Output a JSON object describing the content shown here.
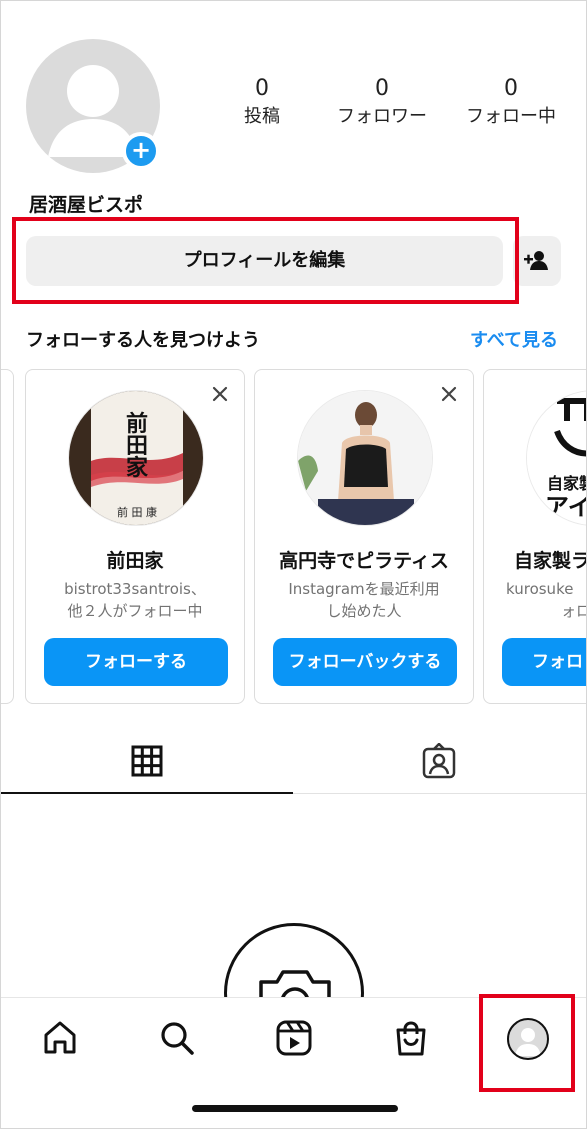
{
  "profile": {
    "name": "居酒屋ビスポ",
    "stats": [
      {
        "value": "0",
        "label": "投稿"
      },
      {
        "value": "0",
        "label": "フォロワー"
      },
      {
        "value": "0",
        "label": "フォロー中"
      }
    ],
    "add_badge": "+",
    "edit_label": "プロフィールを編集"
  },
  "suggestions": {
    "title": "フォローする人を見つけよう",
    "see_all": "すべて見る",
    "cards": [
      {
        "name": "前田家",
        "sub1": "bistrot33santrois、",
        "sub2": "他２人がフォロー中",
        "button": "フォローする"
      },
      {
        "name": "高円寺でピラティス",
        "sub1": "Instagramを最近利用",
        "sub2": "し始めた人",
        "button": "フォローバックする"
      },
      {
        "name": "自家製ラ",
        "sub1": "kurosuke",
        "sub2": "ォロ",
        "button": "フォロ"
      }
    ],
    "card3_logo_text": "自家製"
  },
  "colors": {
    "accent": "#0a95f6",
    "link": "#1a8cf0",
    "highlight": "#e2001a"
  },
  "nav": {
    "items": [
      "home-icon",
      "search-icon",
      "reels-icon",
      "shop-icon",
      "profile-avatar"
    ]
  }
}
